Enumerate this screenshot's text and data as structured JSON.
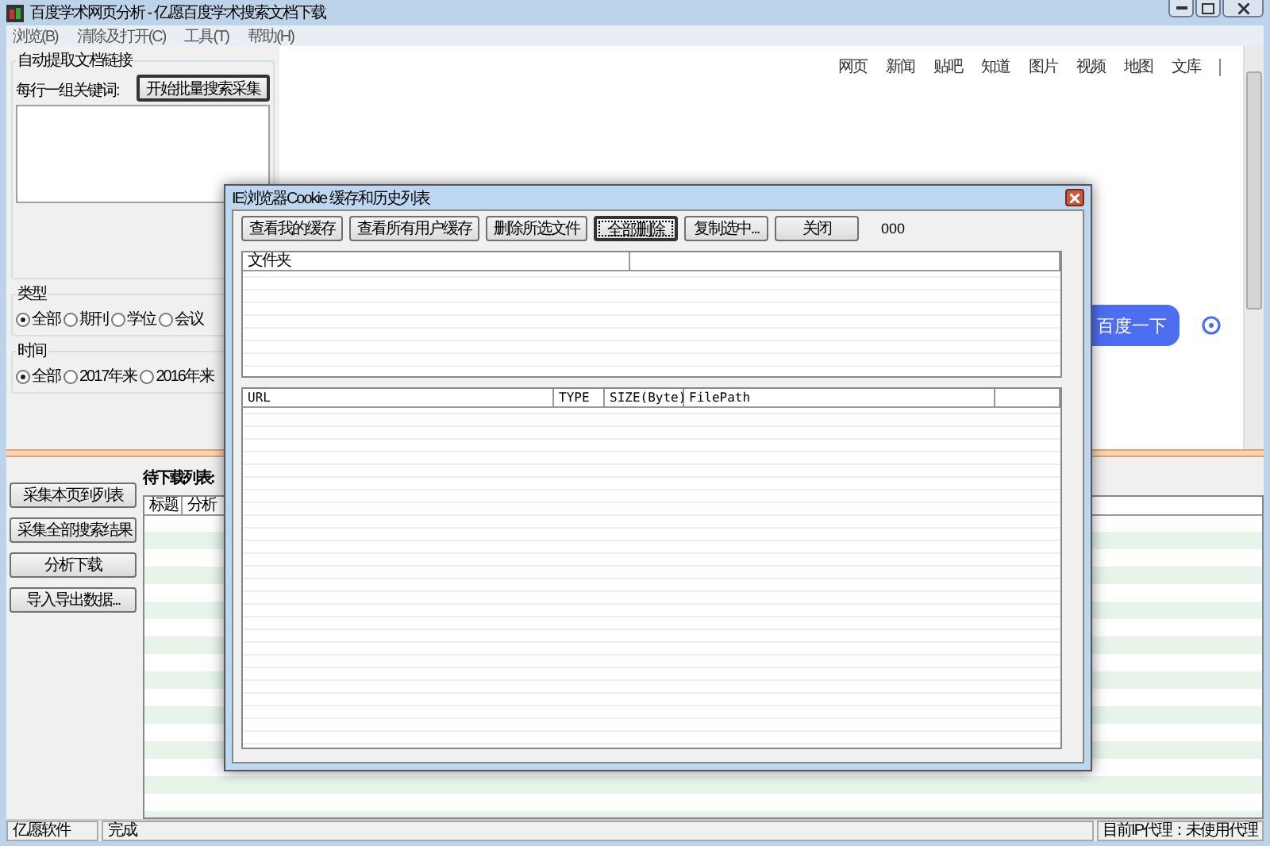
{
  "window": {
    "title": "百度学术网页分析 - 亿愿百度学术搜索文档下载"
  },
  "menu": [
    "浏览(B)",
    "清除及打开(C)",
    "工具(T)",
    "帮助(H)"
  ],
  "keyword_panel": {
    "title": "自动提取文档链接",
    "start_button": "开始批量搜索采集",
    "keywords_label": "每行一组关键词:"
  },
  "type_group": {
    "title": "类型",
    "options": [
      {
        "label": "全部",
        "selected": true
      },
      {
        "label": "期刊",
        "selected": false
      },
      {
        "label": "学位",
        "selected": false
      },
      {
        "label": "会议",
        "selected": false
      }
    ]
  },
  "time_group": {
    "title": "时间",
    "options": [
      {
        "label": "全部",
        "selected": true
      },
      {
        "label": "2017年来",
        "selected": false
      },
      {
        "label": "2016年来",
        "selected": false
      }
    ]
  },
  "browser": {
    "nav_links": [
      "网页",
      "新闻",
      "贴吧",
      "知道",
      "图片",
      "视频",
      "地图",
      "文库"
    ],
    "search_button": "百度一下"
  },
  "actions": [
    "采集本页到列表",
    "采集全部搜索结果",
    "分析下载",
    "导入导出数据..."
  ],
  "download_list": {
    "title": "待下载列表:",
    "columns": [
      "标题",
      "分析"
    ]
  },
  "dialog": {
    "title": "IE浏览器Cookie 缓存和历史列表",
    "buttons": [
      {
        "label": "查看我的缓存",
        "focused": false
      },
      {
        "label": "查看所有用户缓存",
        "focused": false
      },
      {
        "label": "删除所选文件",
        "focused": false
      },
      {
        "label": "全部删除",
        "focused": true
      },
      {
        "label": "复制选中...",
        "focused": false
      },
      {
        "label": "关闭",
        "focused": false
      }
    ],
    "count": "000",
    "folder_list": {
      "columns": [
        "文件夹"
      ]
    },
    "file_list": {
      "columns": [
        "URL",
        "TYPE",
        "SIZE(Byte)",
        "FilePath"
      ]
    }
  },
  "status_bar": [
    "亿愿软件",
    "完成",
    "目前IP代理：未使用代理"
  ]
}
